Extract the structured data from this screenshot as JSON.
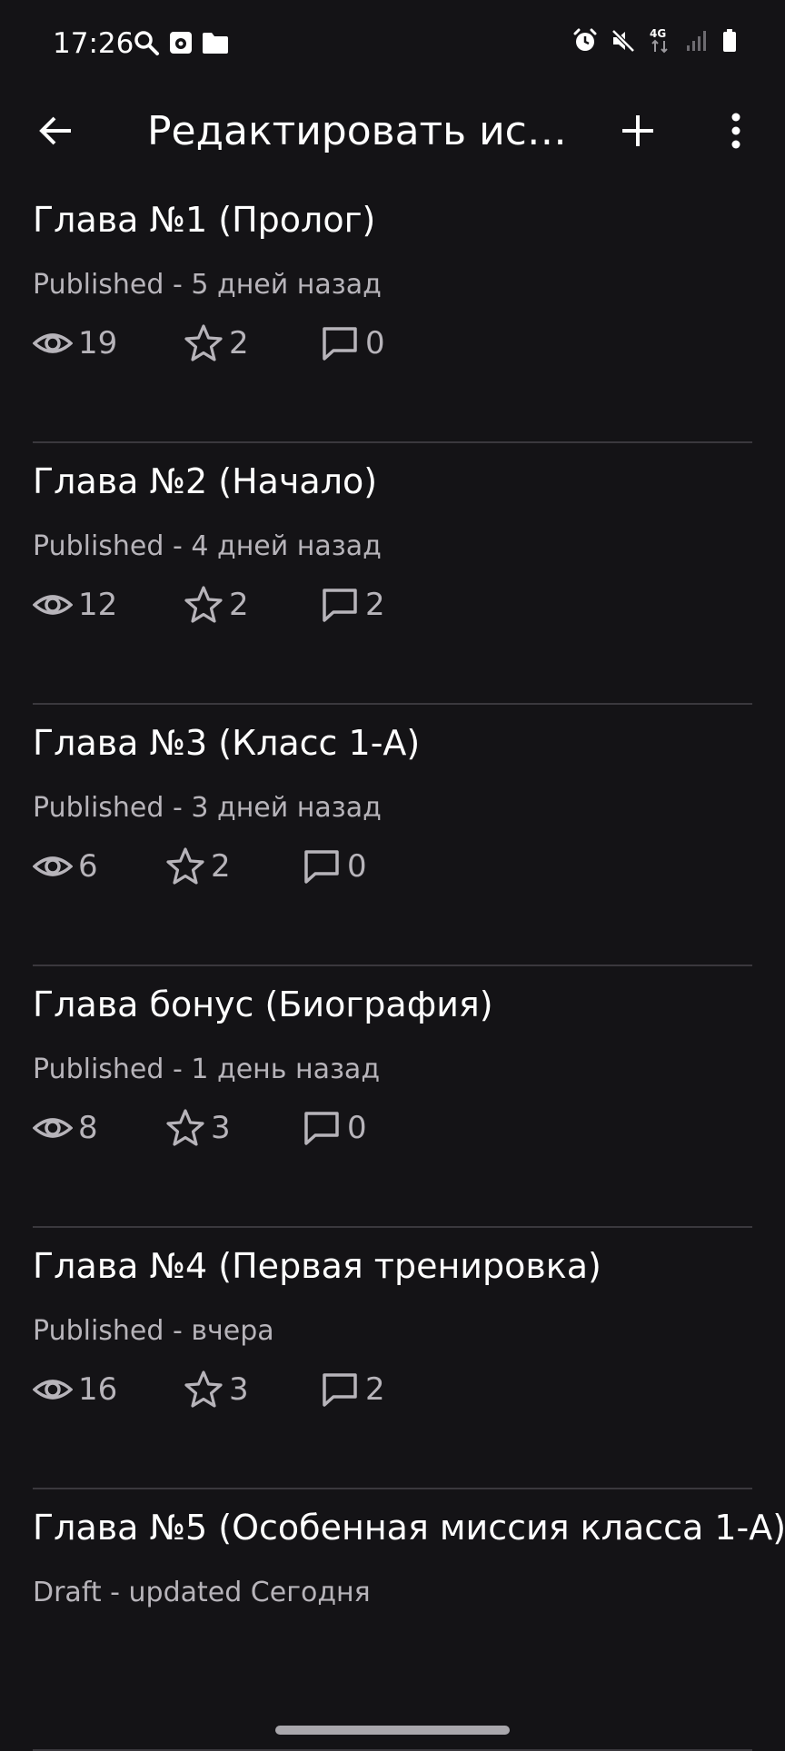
{
  "status_bar": {
    "time": "17:26",
    "network": "4G",
    "icons_left": [
      "search-icon",
      "camera-icon",
      "folder-icon"
    ],
    "icons_right": [
      "alarm-icon",
      "mute-icon",
      "network-4g-icon",
      "signal-icon",
      "battery-icon"
    ]
  },
  "app_bar": {
    "title": "Редактировать исто...",
    "back_icon": "arrow-left-icon",
    "add_icon": "plus-icon",
    "more_icon": "more-vertical-icon"
  },
  "chapters": [
    {
      "title": "Глава №1 (Пролог)",
      "status": "Published - 5 дней назад",
      "views": "19",
      "stars": "2",
      "comments": "0"
    },
    {
      "title": "Глава №2 (Начало)",
      "status": "Published - 4 дней назад",
      "views": "12",
      "stars": "2",
      "comments": "2"
    },
    {
      "title": "Глава №3 (Класс 1-А)",
      "status": "Published - 3 дней назад",
      "views": "6",
      "stars": "2",
      "comments": "0"
    },
    {
      "title": "Глава бонус (Биография)",
      "status": "Published - 1 день назад",
      "views": "8",
      "stars": "3",
      "comments": "0"
    },
    {
      "title": "Глава №4 (Первая тренировка)",
      "status": "Published - вчера",
      "views": "16",
      "stars": "3",
      "comments": "2"
    },
    {
      "title": "Глава №5 (Особенная миссия класса 1-А)",
      "status": "Draft - updated Сегодня"
    }
  ],
  "colors": {
    "background": "#141316",
    "text_primary": "#ffffff",
    "text_secondary": "#b7b4ba",
    "divider": "#3a383d"
  }
}
